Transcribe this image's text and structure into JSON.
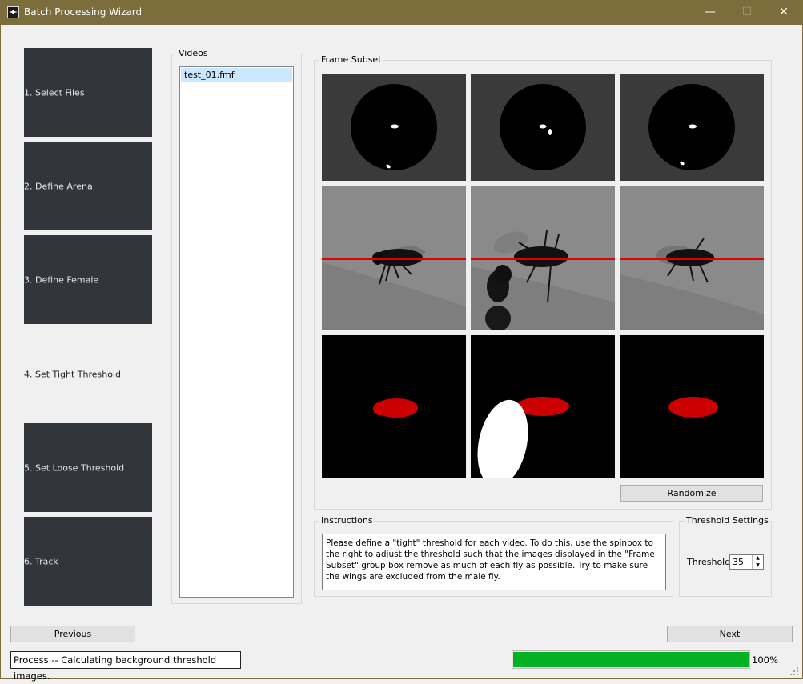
{
  "window": {
    "title": "Batch Processing Wizard",
    "minimize_glyph": "—",
    "maximize_glyph": "☐",
    "close_glyph": "✕"
  },
  "steps": [
    {
      "label": "1. Select Files",
      "active": false
    },
    {
      "label": "2. Define Arena",
      "active": false
    },
    {
      "label": "3. Define Female",
      "active": false
    },
    {
      "label": "4. Set Tight Threshold",
      "active": true
    },
    {
      "label": "5. Set Loose Threshold",
      "active": false
    },
    {
      "label": "6. Track",
      "active": false
    }
  ],
  "videos": {
    "title": "Videos",
    "items": [
      "test_01.fmf"
    ],
    "selected_index": 0
  },
  "frame_subset": {
    "title": "Frame Subset",
    "randomize_label": "Randomize"
  },
  "instructions": {
    "title": "Instructions",
    "text": "Please define a \"tight\" threshold for each video. To do this, use the spinbox to the right to adjust the threshold such that the images displayed in the \"Frame Subset\" group box remove as much of each fly as possible. Try to make sure the wings are excluded from the male fly."
  },
  "threshold_settings": {
    "title": "Threshold Settings",
    "label": "Threshold",
    "value": "35"
  },
  "nav": {
    "previous_label": "Previous",
    "next_label": "Next"
  },
  "status": {
    "text": "Process -- Calculating background threshold images.",
    "progress_value": 100,
    "progress_text": "100%"
  },
  "colors": {
    "step_bg": "#32363a",
    "progress_fill": "#06b025",
    "mask_red": "#cc0000",
    "crosshair_red": "#e00000",
    "selection": "#cce8ff",
    "titlebar": "#7c6d3d"
  }
}
